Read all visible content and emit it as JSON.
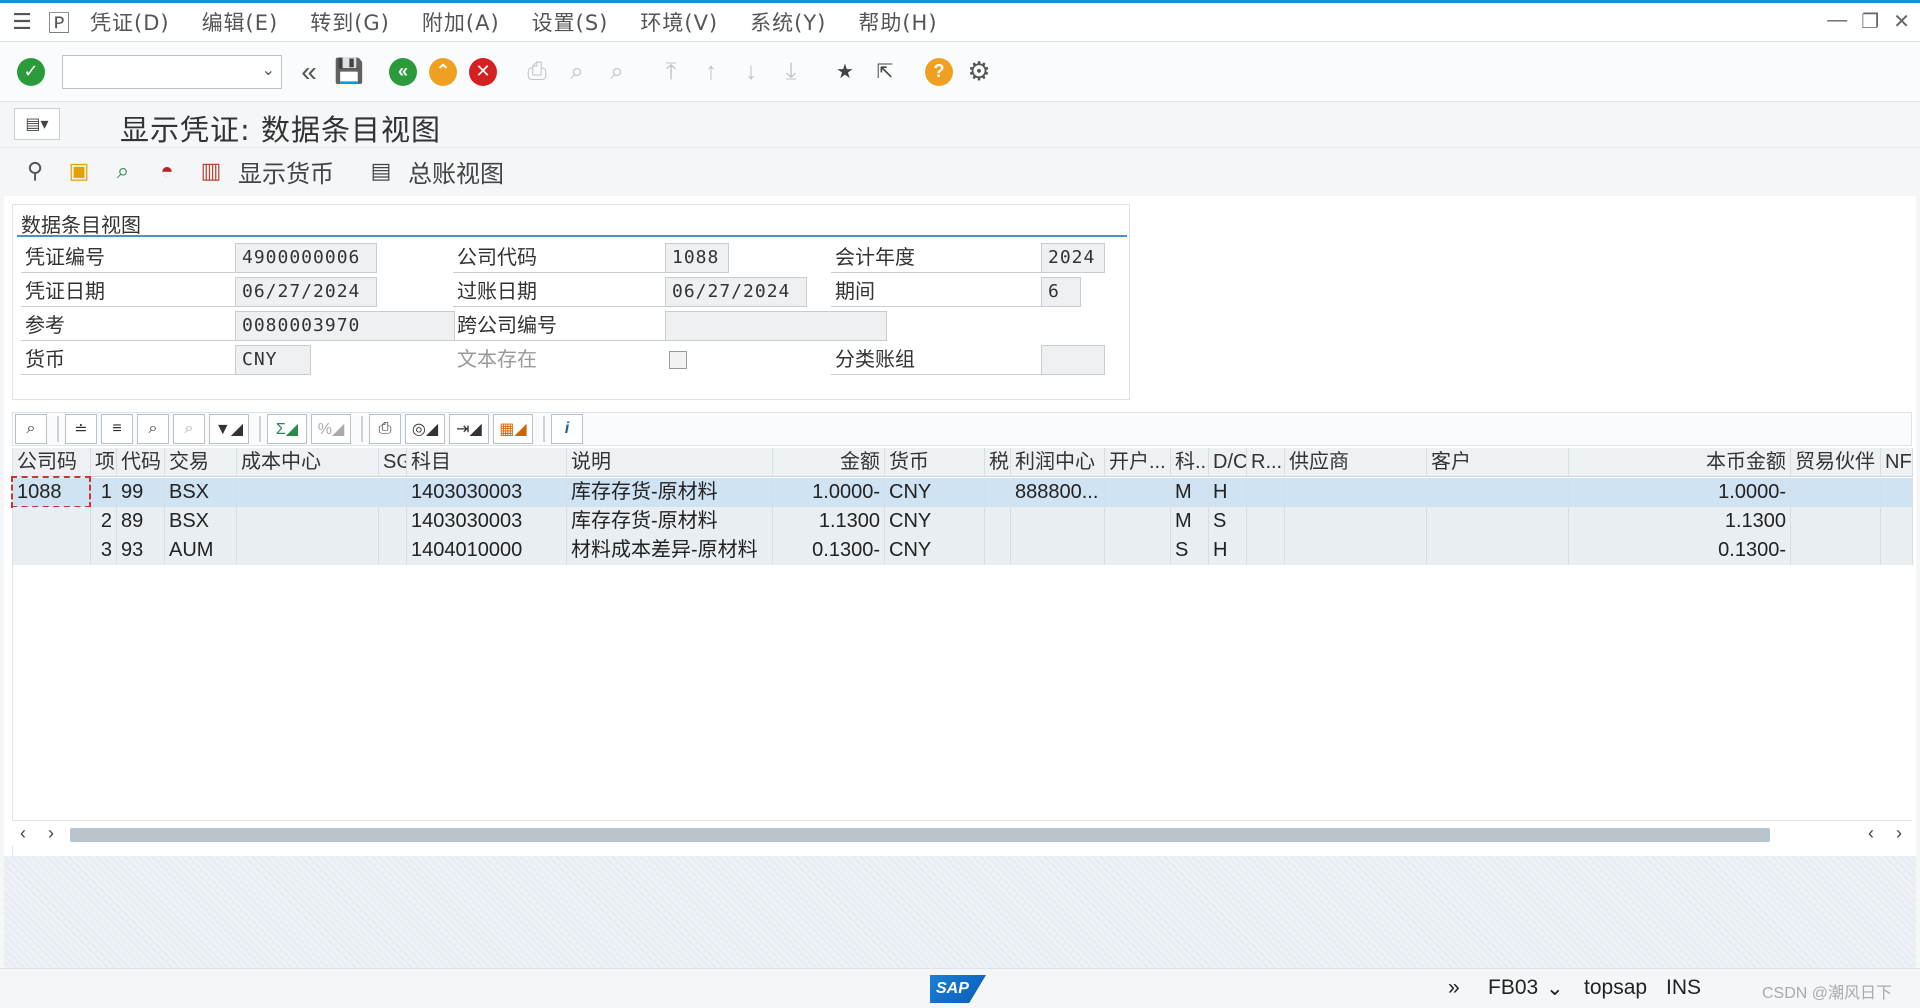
{
  "menubar": {
    "items": [
      "凭证(D)",
      "编辑(E)",
      "转到(G)",
      "附加(A)",
      "设置(S)",
      "环境(V)",
      "系统(Y)",
      "帮助(H)"
    ]
  },
  "titlebar": {
    "title": "显示凭证: 数据条目视图"
  },
  "app_toolbar": {
    "display_currency": "显示货币",
    "gl_view": "总账视图"
  },
  "header": {
    "group_title": "数据条目视图",
    "fields": {
      "doc_no_label": "凭证编号",
      "doc_no": "4900000006",
      "company_code_label": "公司代码",
      "company_code": "1088",
      "fiscal_year_label": "会计年度",
      "fiscal_year": "2024",
      "doc_date_label": "凭证日期",
      "doc_date": "06/27/2024",
      "posting_date_label": "过账日期",
      "posting_date": "06/27/2024",
      "period_label": "期间",
      "period": "6",
      "reference_label": "参考",
      "reference": "0080003970",
      "cross_cc_label": "跨公司编号",
      "cross_cc": "",
      "currency_label": "货币",
      "currency": "CNY",
      "text_exists_label": "文本存在",
      "ledger_group_label": "分类账组",
      "ledger_group": ""
    }
  },
  "grid": {
    "columns": [
      "公司码",
      "项",
      "代码",
      "交易",
      "成本中心",
      "SG",
      "科目",
      "说明",
      "金额",
      "货币",
      "税",
      "利润中心",
      "开户...",
      "科...",
      "D/C",
      "R...",
      "供应商",
      "客户",
      "本币金额",
      "贸易伙伴",
      "NF"
    ],
    "rows": [
      {
        "cc": "1088",
        "item": "1",
        "key": "99",
        "trans": "BSX",
        "account": "1403030003",
        "desc": "库存存货-原材料",
        "amount": "1.0000-",
        "curr": "CNY",
        "profit": "888800...",
        "acct_type": "M",
        "dc": "H",
        "local": "1.0000-"
      },
      {
        "cc": "",
        "item": "2",
        "key": "89",
        "trans": "BSX",
        "account": "1403030003",
        "desc": "库存存货-原材料",
        "amount": "1.1300",
        "curr": "CNY",
        "profit": "",
        "acct_type": "M",
        "dc": "S",
        "local": "1.1300"
      },
      {
        "cc": "",
        "item": "3",
        "key": "93",
        "trans": "AUM",
        "account": "1404010000",
        "desc": "材料成本差异-原材料",
        "amount": "0.1300-",
        "curr": "CNY",
        "profit": "",
        "acct_type": "S",
        "dc": "H",
        "local": "0.1300-"
      }
    ]
  },
  "status": {
    "tcode": "FB03",
    "system": "topsap",
    "mode": "INS",
    "watermark": "CSDN @潮风日下"
  },
  "colors": {
    "accent": "#1a8fd8",
    "selected_row": "#cfe3f2",
    "green": "#2a9a3a",
    "orange": "#f0a020",
    "red": "#d42020"
  }
}
